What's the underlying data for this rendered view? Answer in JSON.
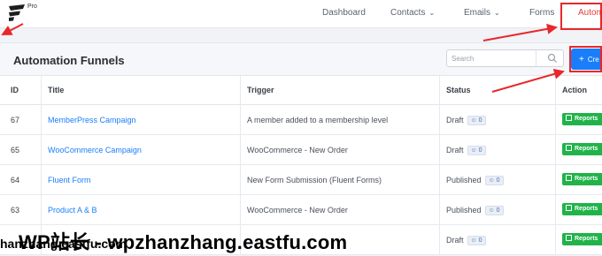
{
  "app": {
    "logo_badge": "Pro"
  },
  "nav": {
    "items": [
      {
        "label": "Dashboard",
        "has_dropdown": false
      },
      {
        "label": "Contacts",
        "has_dropdown": true
      },
      {
        "label": "Emails",
        "has_dropdown": true
      },
      {
        "label": "Forms",
        "has_dropdown": false
      },
      {
        "label": "Autom",
        "has_dropdown": false
      }
    ]
  },
  "header": {
    "title": "Automation Funnels",
    "search_placeholder": "Search",
    "create_label": "Cre"
  },
  "table": {
    "columns": [
      "ID",
      "Title",
      "Trigger",
      "Status",
      "Action"
    ],
    "rows": [
      {
        "id": "67",
        "title": "MemberPress Campaign",
        "trigger": "A member added to a membership level",
        "status": "Draft",
        "subscribers": "0",
        "action": "Reports"
      },
      {
        "id": "65",
        "title": "WooCommerce Campaign",
        "trigger": "WooCommerce - New Order",
        "status": "Draft",
        "subscribers": "0",
        "action": "Reports"
      },
      {
        "id": "64",
        "title": "Fluent Form",
        "trigger": "New Form Submission (Fluent Forms)",
        "status": "Published",
        "subscribers": "0",
        "action": "Reports"
      },
      {
        "id": "63",
        "title": "Product A & B",
        "trigger": "WooCommerce - New Order",
        "status": "Published",
        "subscribers": "0",
        "action": "Reports"
      },
      {
        "id": "",
        "title": "",
        "trigger": "",
        "status": "Draft",
        "subscribers": "0",
        "action": "Reports"
      }
    ]
  },
  "watermark": {
    "main": "WP站长 - wpzhanzhang.eastfu.com",
    "secondary": "hanzhang.eastfu.com"
  },
  "colors": {
    "accent": "#1a7efb",
    "report_green": "#21b34a",
    "highlight_red": "#e8282b"
  }
}
